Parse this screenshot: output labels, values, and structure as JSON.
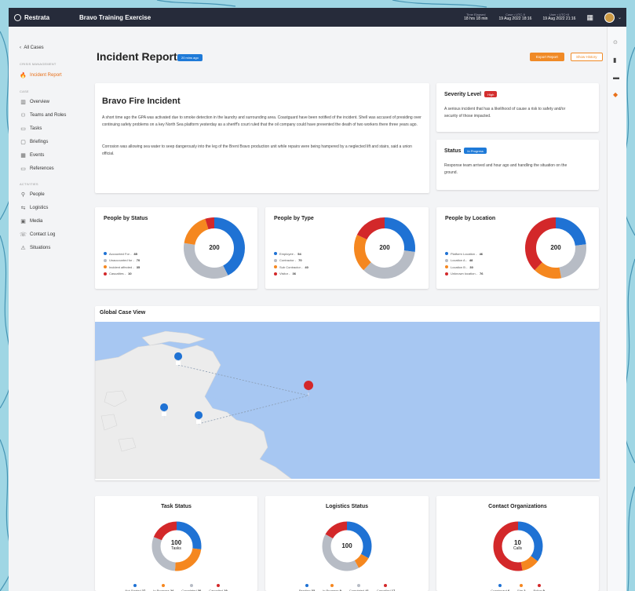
{
  "app": {
    "brand": "Restrata",
    "exercise_title": "Bravo Training Exercise",
    "time_elapsed_label": "Time Elapsed",
    "time_elapsed_value": "18 hrs 18 min",
    "case_label": "Case • UTC-9",
    "case_value": "19 Aug 2022  18:16",
    "user_label": "User • UTC+8",
    "user_value": "19 Aug 2022  21:16"
  },
  "sidebar": {
    "back": "All Cases",
    "section_crisis": "CRISIS MANAGEMENT",
    "incident_report": "Incident Report",
    "section_case": "CASE",
    "case_items": [
      "Overview",
      "Teams and Roles",
      "Tasks",
      "Briefings",
      "Events",
      "References"
    ],
    "section_activities": "ACTIVITIES",
    "activity_items": [
      "People",
      "Logistics",
      "Media",
      "Contact Log",
      "Situations"
    ]
  },
  "header": {
    "title": "Incident Report",
    "time_badge": "20 mins ago",
    "export_button": "Export Report",
    "history_button": "Show History"
  },
  "incident": {
    "title": "Bravo Fire Incident",
    "paragraph1": "A short time ago the GPA was activated due to smoke detection in the laundry and surrounding area. Coastguard have been notified of the incident. Shell was accused of presiding over continuing safety problems on a key North Sea platform yesterday as a sheriff's court ruled that the oil company could have prevented the death of two workers there three years ago.",
    "paragraph2": "Corrosion was allowing sea water to seep dangerously into the leg of the Brent Bravo production unit while repairs were being hampered by a neglected lift and stairs, said a union official."
  },
  "severity": {
    "title": "Severity Level",
    "tag": "High",
    "tag_color": "#d32f2f",
    "text": "A serious incident that has a likelihood of cause a risk to safety and/or security of those impacted."
  },
  "status": {
    "title": "Status",
    "tag": "In Progress",
    "tag_color": "#1e7ad8",
    "text": "Response team arrived and hour ago and handling the situation on the ground."
  },
  "colors": {
    "blue": "#1f72d4",
    "gray": "#b7bcc5",
    "orange": "#f5871f",
    "red": "#d3282a",
    "map_water": "#a7c7f2",
    "map_land": "#ececec",
    "brand_orange": "#f08a26"
  },
  "charts": {
    "people_by_status": {
      "title": "People by Status",
      "total": "200",
      "legend": [
        {
          "label": "Accounted For",
          "value": "85",
          "color": "#1f72d4"
        },
        {
          "label": "Unaccounted for",
          "value": "70",
          "color": "#b7bcc5"
        },
        {
          "label": "Incident affected",
          "value": "35",
          "color": "#f5871f"
        },
        {
          "label": "Casualties",
          "value": "10",
          "color": "#d3282a"
        }
      ]
    },
    "people_by_type": {
      "title": "People by Type",
      "total": "200",
      "legend": [
        {
          "label": "Employee",
          "value": "54",
          "color": "#1f72d4"
        },
        {
          "label": "Contractor",
          "value": "70",
          "color": "#b7bcc5"
        },
        {
          "label": "Sub Contractor",
          "value": "40",
          "color": "#f5871f"
        },
        {
          "label": "Visitor",
          "value": "36",
          "color": "#d3282a"
        }
      ]
    },
    "people_by_location": {
      "title": "People by Location",
      "total": "200",
      "legend": [
        {
          "label": "Platform Location",
          "value": "46",
          "color": "#1f72d4"
        },
        {
          "label": "Location A",
          "value": "48",
          "color": "#b7bcc5"
        },
        {
          "label": "Location B",
          "value": "30",
          "color": "#f5871f"
        },
        {
          "label": "Unknown location",
          "value": "76",
          "color": "#d3282a"
        }
      ]
    },
    "task_status": {
      "title": "Task Status",
      "total": "100",
      "sub": "Tasks",
      "legend": [
        {
          "label": "Not Started",
          "value": "27",
          "color": "#1f72d4"
        },
        {
          "label": "In Progress",
          "value": "24",
          "color": "#f5871f"
        },
        {
          "label": "Completed",
          "value": "30",
          "color": "#b7bcc5"
        },
        {
          "label": "Cancelled",
          "value": "19",
          "color": "#d3282a"
        }
      ]
    },
    "logistics_status": {
      "title": "Logistics Status",
      "total": "100",
      "sub": "",
      "legend": [
        {
          "label": "Pending",
          "value": "33",
          "color": "#1f72d4"
        },
        {
          "label": "In Progress",
          "value": "9",
          "color": "#f5871f"
        },
        {
          "label": "Completed",
          "value": "41",
          "color": "#b7bcc5"
        },
        {
          "label": "Cancelled",
          "value": "17",
          "color": "#d3282a"
        }
      ]
    },
    "contact_orgs": {
      "title": "Contact Organizations",
      "total": "10",
      "sub": "Calls",
      "legend": [
        {
          "label": "Coastguard",
          "value": "6",
          "color": "#1f72d4"
        },
        {
          "label": "Fire",
          "value": "2",
          "color": "#f5871f"
        },
        {
          "label": "Police",
          "value": "9",
          "color": "#d3282a"
        }
      ]
    }
  },
  "map": {
    "title": "Global Case View"
  }
}
